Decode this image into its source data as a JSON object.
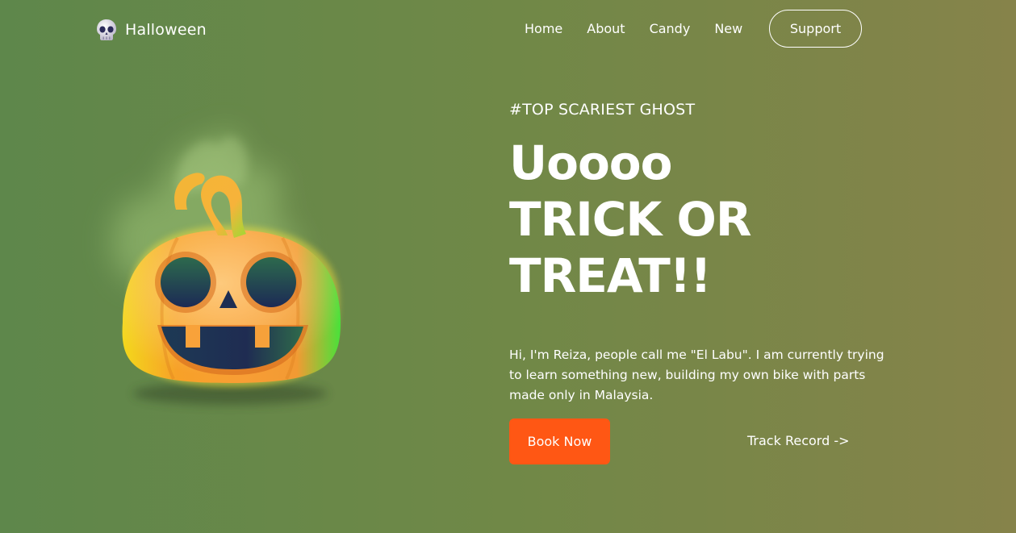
{
  "brand": {
    "name": "Halloween",
    "icon": "skull-icon"
  },
  "nav": {
    "items": [
      {
        "label": "Home"
      },
      {
        "label": "About"
      },
      {
        "label": "Candy"
      },
      {
        "label": "New"
      }
    ],
    "support_label": "Support"
  },
  "hero": {
    "tagline": "#TOP SCARIEST GHOST",
    "headline_lines": [
      "Uoooo",
      "TRICK OR",
      "TREAT!!"
    ],
    "intro": "Hi, I'm Reiza, people call me \"El Labu\". I am currently trying to learn something new, building my own bike with parts made only in Malaysia.",
    "book_label": "Book Now",
    "track_label": "Track Record ->",
    "art_icon": "jack-o-lantern-icon"
  },
  "colors": {
    "background_left": "#5e874b",
    "background_right": "#86834a",
    "accent": "#ff5714",
    "text": "#ffffff"
  }
}
